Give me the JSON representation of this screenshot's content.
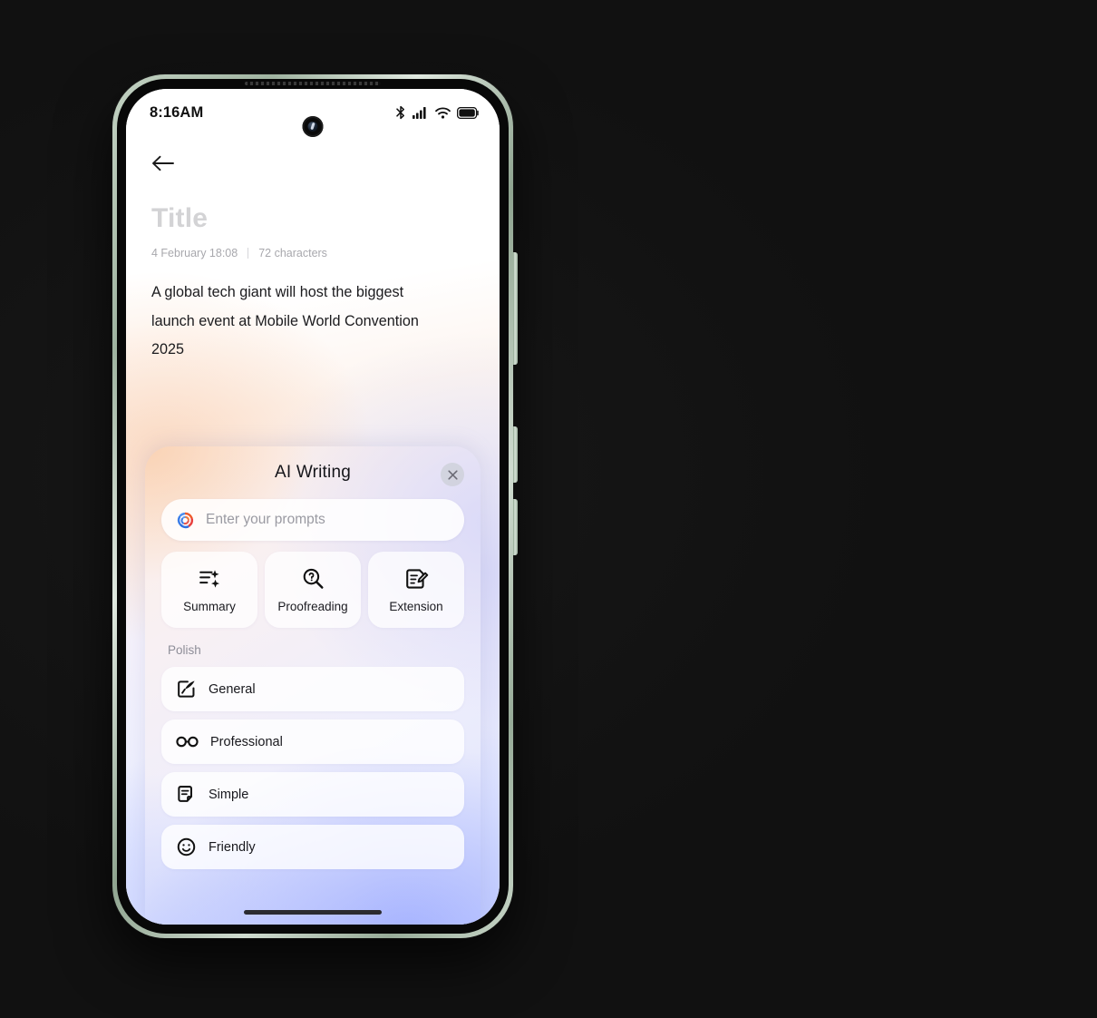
{
  "status_bar": {
    "time": "8:16AM",
    "icons": [
      "bluetooth-icon",
      "cellular-signal-icon",
      "wifi-icon",
      "battery-icon"
    ]
  },
  "note": {
    "back_label": "back-arrow",
    "title_placeholder": "Title",
    "date": "4 February 18:08",
    "char_count": "72 characters",
    "body": "A global tech giant will host the biggest launch event at Mobile World Convention 2025"
  },
  "ai_panel": {
    "title": "AI Writing",
    "close_label": "×",
    "prompt_placeholder": "Enter your prompts",
    "actions": [
      {
        "label": "Summary",
        "icon": "summary-sparkle-icon"
      },
      {
        "label": "Proofreading",
        "icon": "magnifier-question-icon"
      },
      {
        "label": "Extension",
        "icon": "document-pencil-icon"
      }
    ],
    "polish_section_label": "Polish",
    "polish_options": [
      {
        "label": "General",
        "icon": "quill-edit-icon"
      },
      {
        "label": "Professional",
        "icon": "glasses-icon"
      },
      {
        "label": "Simple",
        "icon": "document-icon"
      },
      {
        "label": "Friendly",
        "icon": "smiley-icon"
      }
    ]
  },
  "colors": {
    "panel_warm": "#fdeee4",
    "panel_cool": "#dde3ff",
    "accent_blue": "#3b6fe0",
    "accent_orange": "#ef6a33",
    "text_primary": "#18181d",
    "text_muted": "#8e8e98",
    "frame_green": "#b6c8b7"
  }
}
